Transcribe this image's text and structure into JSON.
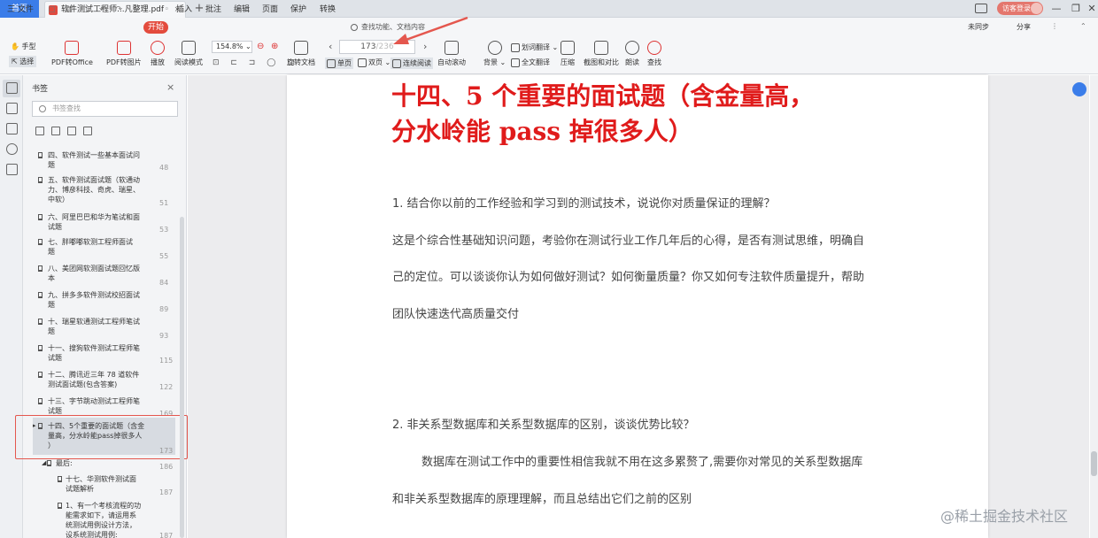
{
  "tabs": {
    "home": "首页",
    "document": "软件测试工程师...凡整理.pdf",
    "new_tab": "+"
  },
  "login": "访客登录",
  "menu": {
    "file": "三 文件",
    "items": [
      "开始",
      "插入",
      "批注",
      "编辑",
      "页面",
      "保护",
      "转换"
    ],
    "search_placeholder": "查找功能、文档内容",
    "right": [
      "未同步",
      "分享"
    ]
  },
  "toolbar": {
    "hand": "手型",
    "select": "选择",
    "pdf_to_office": "PDF转Office",
    "pdf_to_image": "PDF转图片",
    "play": "播放",
    "read_mode": "阅读模式",
    "zoom": "154.8%",
    "rotate": "旋转文档",
    "page_current": "173",
    "page_total": "/236",
    "single": "单页",
    "double": "双页",
    "continuous": "连续阅读",
    "auto_scroll": "自动滚动",
    "background": "背景",
    "translate": "划词翻译",
    "full_translate": "全文翻译",
    "compress": "压缩",
    "screenshot_compare": "截图和对比",
    "read_aloud": "朗读",
    "find": "查找"
  },
  "sidebar": {
    "title": "书签",
    "search_placeholder": "书签查找",
    "bookmarks": [
      {
        "lines": [
          "四、软件测试一些基本面试问",
          "题"
        ],
        "page": "48"
      },
      {
        "lines": [
          "五、软件测试面试题（软通动",
          "力、博彦科技、奇虎、瑞星、",
          "中软）"
        ],
        "page": "51"
      },
      {
        "lines": [
          "六、阿里巴巴和华为笔试和面",
          "试题"
        ],
        "page": "53"
      },
      {
        "lines": [
          "七、胖嘟嘟软测工程师面试",
          "题"
        ],
        "page": "55"
      },
      {
        "lines": [
          "八、美团网软测面试题回忆版",
          "本"
        ],
        "page": "84"
      },
      {
        "lines": [
          "九、拼多多软件测试校招面试",
          "题"
        ],
        "page": "89"
      },
      {
        "lines": [
          "十、瑞星软通测试工程师笔试",
          "题"
        ],
        "page": "93"
      },
      {
        "lines": [
          "十一、搜狗软件测试工程师笔",
          "试题"
        ],
        "page": "115"
      },
      {
        "lines": [
          "十二、腾讯近三年 78 道软件",
          "测试面试题(包含答案)"
        ],
        "page": "122"
      },
      {
        "lines": [
          "十三、字节跳动测试工程师笔",
          "试题"
        ],
        "page": "169"
      },
      {
        "lines": [
          "十四、5个重要的面试题（含金",
          "量高，分水岭能pass掉很多人",
          "）"
        ],
        "page": "173"
      },
      {
        "lines": [
          "最后:"
        ],
        "page": "186"
      },
      {
        "lines": [
          "十七、华测软件测试面",
          "试题解析"
        ],
        "page": "187"
      },
      {
        "lines": [
          "1、有一个考核流程的功",
          "能需求如下，请运用系",
          "统测试用例设计方法，",
          "设系统测试用例:"
        ],
        "page": "187"
      }
    ]
  },
  "document": {
    "heading_line1": "十四、5 个重要的面试题（含金量高，",
    "heading_line2": "分水岭能 pass 掉很多人）",
    "q1": "1.  结合你以前的工作经验和学习到的测试技术，说说你对质量保证的理解？",
    "a1_line1": "这是个综合性基础知识问题，考验你在测试行业工作几年后的心得，是否有测试思维，明确自",
    "a1_line2": "己的定位。可以谈谈你认为如何做好测试？如何衡量质量？你又如何专注软件质量提升，帮助",
    "a1_line3": "团队快速迭代高质量交付",
    "q2": "2.  非关系型数据库和关系型数据库的区别，谈谈优势比较？",
    "a2_line1": "        数据库在测试工作中的重要性相信我就不用在这多累赘了,需要你对常见的关系型数据库",
    "a2_line2": "和非关系型数据库的原理理解，而且总结出它们之前的区别"
  },
  "watermark": "@稀土掘金技术社区",
  "colors": {
    "accent": "#3b7de9",
    "brand_red": "#e34b3d",
    "heading_red": "#e01b1b",
    "highlight_box": "#e4574e"
  }
}
